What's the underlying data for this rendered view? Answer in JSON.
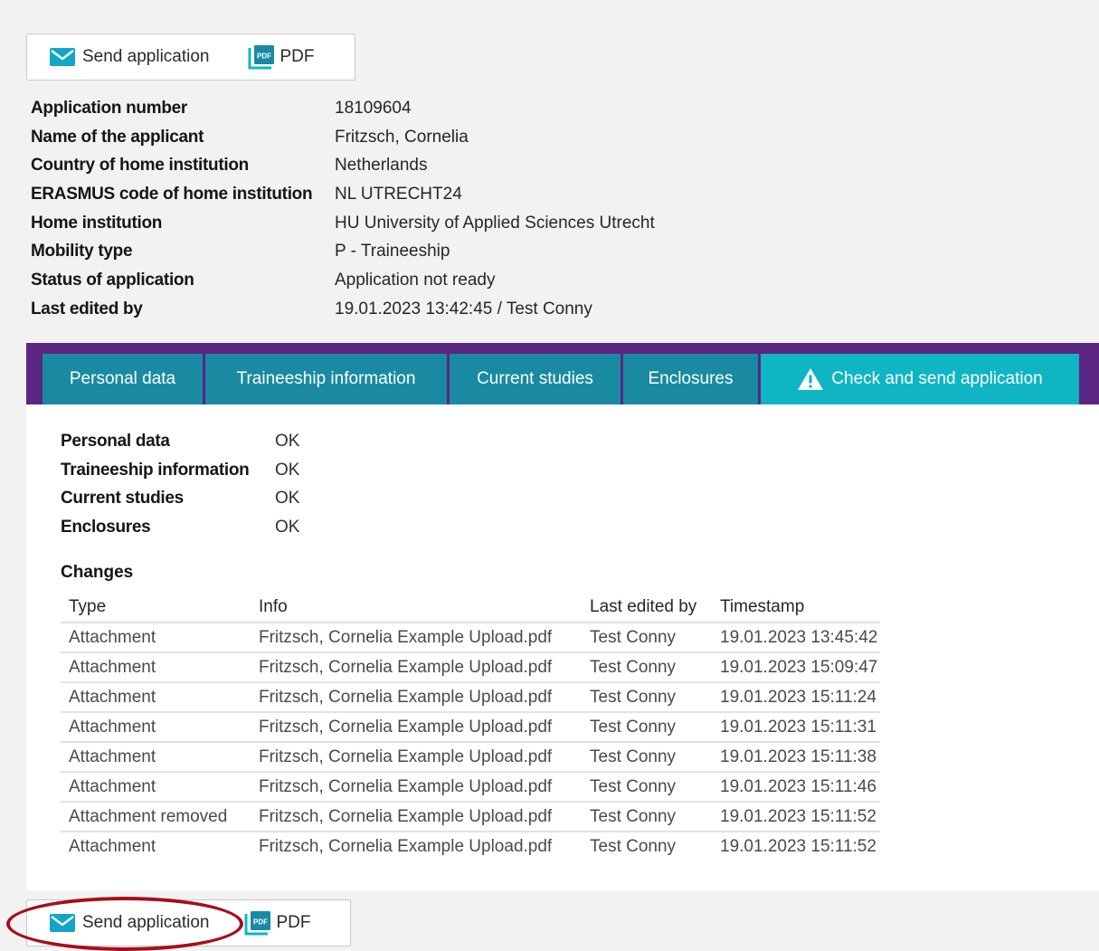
{
  "toolbar": {
    "send_label": "Send application",
    "pdf_label": "PDF",
    "icons": {
      "send": "envelope-icon",
      "pdf": "pdf-file-icon"
    }
  },
  "summary": {
    "rows": [
      {
        "label": "Application number",
        "value": "18109604"
      },
      {
        "label": "Name of the applicant",
        "value": "Fritzsch, Cornelia"
      },
      {
        "label": "Country of home institution",
        "value": "Netherlands"
      },
      {
        "label": "ERASMUS code of home institution",
        "value": "NL UTRECHT24"
      },
      {
        "label": "Home institution",
        "value": "HU University of Applied Sciences Utrecht"
      },
      {
        "label": "Mobility type",
        "value": "P - Traineeship"
      },
      {
        "label": "Status of application",
        "value": "Application not ready"
      },
      {
        "label": "Last edited by",
        "value": "19.01.2023 13:42:45 / Test Conny"
      }
    ]
  },
  "tabs": [
    {
      "label": "Personal data"
    },
    {
      "label": "Traineeship information"
    },
    {
      "label": "Current studies"
    },
    {
      "label": "Enclosures"
    },
    {
      "label": "Check and send application",
      "active": true,
      "icon": "warning-icon"
    }
  ],
  "checks": [
    {
      "label": "Personal data",
      "status": "OK"
    },
    {
      "label": "Traineeship information",
      "status": "OK"
    },
    {
      "label": "Current studies",
      "status": "OK"
    },
    {
      "label": "Enclosures",
      "status": "OK"
    }
  ],
  "changes": {
    "title": "Changes",
    "columns": [
      "Type",
      "Info",
      "Last edited by",
      "Timestamp"
    ],
    "rows": [
      [
        "Attachment",
        "Fritzsch, Cornelia Example Upload.pdf",
        "Test Conny",
        "19.01.2023 13:45:42"
      ],
      [
        "Attachment",
        "Fritzsch, Cornelia Example Upload.pdf",
        "Test Conny",
        "19.01.2023 15:09:47"
      ],
      [
        "Attachment",
        "Fritzsch, Cornelia Example Upload.pdf",
        "Test Conny",
        "19.01.2023 15:11:24"
      ],
      [
        "Attachment",
        "Fritzsch, Cornelia Example Upload.pdf",
        "Test Conny",
        "19.01.2023 15:11:31"
      ],
      [
        "Attachment",
        "Fritzsch, Cornelia Example Upload.pdf",
        "Test Conny",
        "19.01.2023 15:11:38"
      ],
      [
        "Attachment",
        "Fritzsch, Cornelia Example Upload.pdf",
        "Test Conny",
        "19.01.2023 15:11:46"
      ],
      [
        "Attachment removed",
        "Fritzsch, Cornelia Example Upload.pdf",
        "Test Conny",
        "19.01.2023 15:11:52"
      ],
      [
        "Attachment",
        "Fritzsch, Cornelia Example Upload.pdf",
        "Test Conny",
        "19.01.2023 15:11:52"
      ]
    ]
  },
  "colors": {
    "tabbar": "#5a2583",
    "tab": "#1a8aa3",
    "tab_active": "#0fb5c2",
    "envelope": "#14a6c6",
    "highlight": "#a50f1b"
  }
}
